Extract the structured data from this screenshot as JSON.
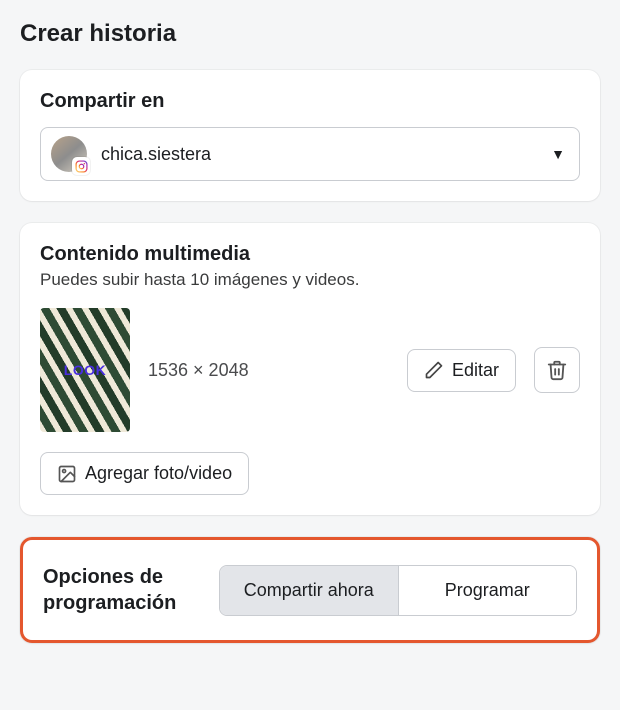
{
  "page": {
    "title": "Crear historia"
  },
  "share": {
    "section_title": "Compartir en",
    "account_name": "chica.siestera"
  },
  "media": {
    "section_title": "Contenido multimedia",
    "subtitle": "Puedes subir hasta 10 imágenes y videos.",
    "dimensions": "1536 × 2048",
    "edit_label": "Editar",
    "add_label": "Agregar foto/video",
    "thumb_watermark": "LOOK"
  },
  "schedule": {
    "section_title": "Opciones de programación",
    "share_now_label": "Compartir ahora",
    "schedule_label": "Programar",
    "active": "share_now"
  }
}
